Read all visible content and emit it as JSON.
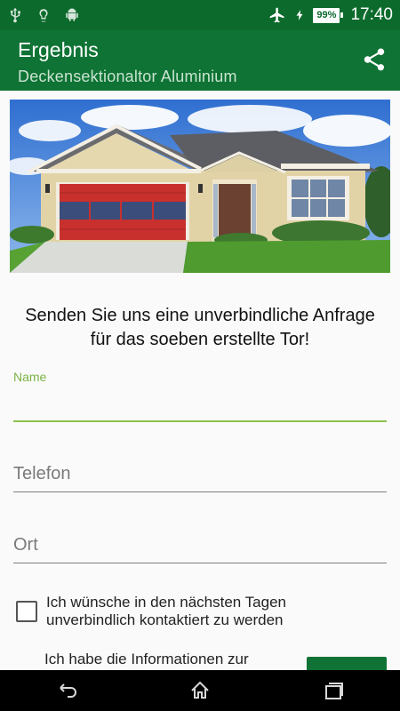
{
  "status_bar": {
    "left_icons": [
      "usb-icon",
      "lightbulb-icon",
      "android-icon"
    ],
    "right_icons": [
      "airplane-mode-icon",
      "charging-bolt-icon"
    ],
    "battery": "99%",
    "time": "17:40"
  },
  "app_bar": {
    "title": "Ergebnis",
    "subtitle": "Deckensektionaltor Aluminium",
    "share_icon": "share-icon"
  },
  "hero": {
    "image": "house-with-red-sectional-garage-door",
    "door_color": "#c8302e"
  },
  "form": {
    "headline": "Senden Sie uns eine unverbindliche Anfrage für das soeben erstellte Tor!",
    "name": {
      "label": "Name",
      "value": ""
    },
    "phone": {
      "placeholder": "Telefon",
      "value": ""
    },
    "city": {
      "placeholder": "Ort",
      "value": ""
    },
    "contact_checkbox": {
      "label": "Ich wünsche in den nächsten Tagen unverbindlich kontaktiert zu werden",
      "checked": false
    },
    "info_text_partial": "Ich habe die Informationen zur"
  },
  "nav_bar": {
    "buttons": [
      "back-icon",
      "home-icon",
      "recents-icon"
    ]
  },
  "colors": {
    "status_bar": "#0c6b2c",
    "app_bar": "#0e7334",
    "accent": "#8dc04f",
    "floating_label": "#7bb344"
  }
}
